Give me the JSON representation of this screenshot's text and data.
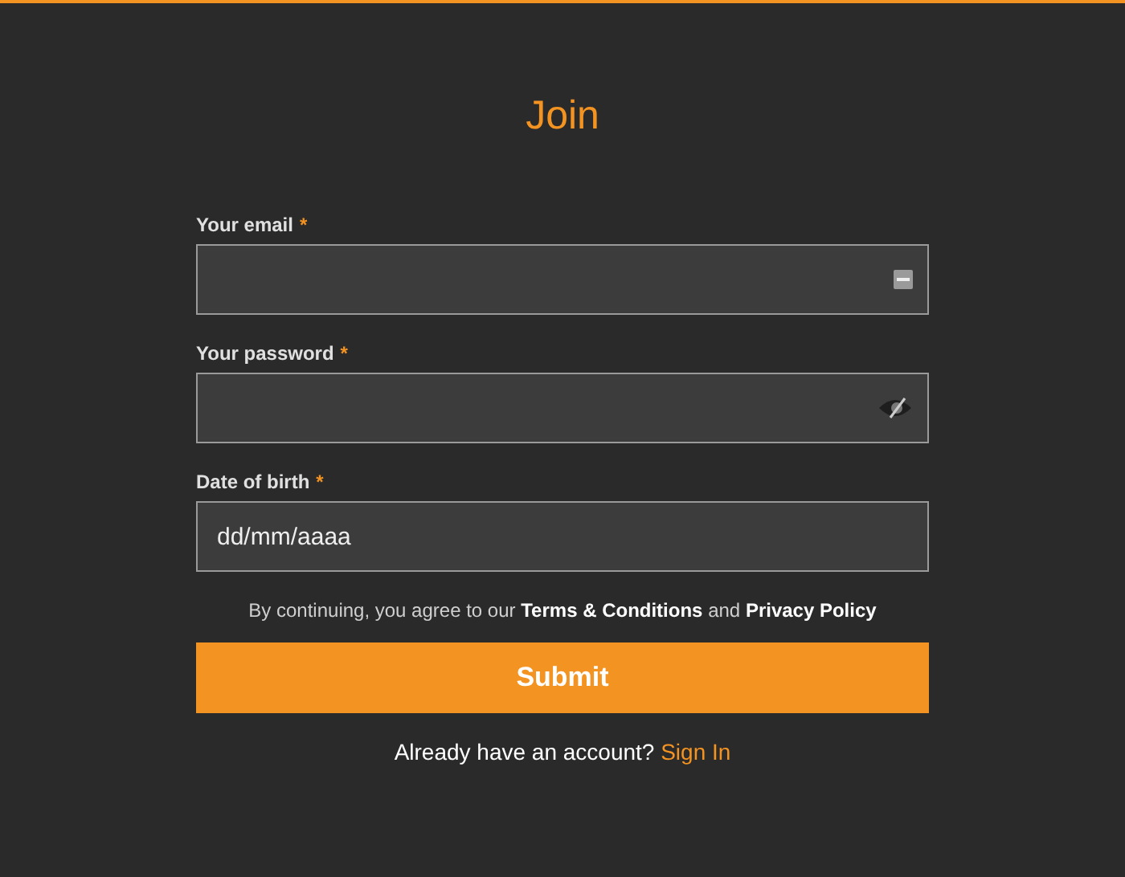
{
  "title": "Join",
  "fields": [
    {
      "label": "Your email",
      "required": "*",
      "kind": "autofill"
    },
    {
      "label": "Your password",
      "required": "*",
      "kind": "eye"
    },
    {
      "label": "Date of birth",
      "required": "*",
      "kind": "date",
      "placeholder": "dd/mm/aaaa"
    }
  ],
  "legal": {
    "before": "By continuing, you agree to our",
    "terms": "Terms & Conditions",
    "middle": "and",
    "privacy": "Privacy Policy"
  },
  "submit": "Submit",
  "signin": {
    "prompt": "Already have an account?",
    "link": "Sign In"
  }
}
